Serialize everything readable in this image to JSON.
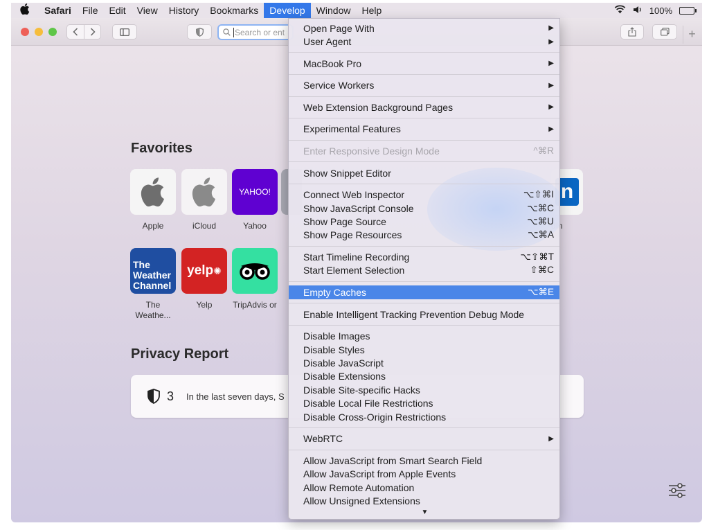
{
  "menubar": {
    "app": "Safari",
    "items": [
      "File",
      "Edit",
      "View",
      "History",
      "Bookmarks",
      "Develop",
      "Window",
      "Help"
    ],
    "active": "Develop",
    "battery": "100%",
    "icons": [
      "apple-logo-icon",
      "wifi-icon",
      "volume-icon",
      "battery-icon"
    ]
  },
  "toolbar": {
    "address_placeholder": "Search or ent"
  },
  "favorites": {
    "title": "Favorites",
    "items": [
      {
        "label": "Apple",
        "icon": "apple-logo-icon"
      },
      {
        "label": "iCloud",
        "icon": "apple-logo-icon"
      },
      {
        "label": "Yahoo",
        "tile_text": "YAHOO!"
      },
      {
        "label": "dIn",
        "tile_text": "n"
      },
      {
        "label": "The Weathe...",
        "tile_text": "The Weather Channel"
      },
      {
        "label": "Yelp",
        "tile_text": "yelp"
      },
      {
        "label": "TripAdvis or",
        "icon": "tripadvisor-owl-icon"
      }
    ]
  },
  "privacy": {
    "title": "Privacy Report",
    "count": "3",
    "text": "In the last seven days, S"
  },
  "develop_menu": {
    "groups": [
      [
        {
          "label": "Open Page With",
          "submenu": true
        },
        {
          "label": "User Agent",
          "submenu": true
        }
      ],
      [
        {
          "label": "MacBook Pro",
          "submenu": true
        }
      ],
      [
        {
          "label": "Service Workers",
          "submenu": true
        }
      ],
      [
        {
          "label": "Web Extension Background Pages",
          "submenu": true
        }
      ],
      [
        {
          "label": "Experimental Features",
          "submenu": true
        }
      ],
      [
        {
          "label": "Enter Responsive Design Mode",
          "shortcut": "^⌘R",
          "disabled": true
        }
      ],
      [
        {
          "label": "Show Snippet Editor"
        }
      ],
      [
        {
          "label": "Connect Web Inspector",
          "shortcut": "⌥⇧⌘I"
        },
        {
          "label": "Show JavaScript Console",
          "shortcut": "⌥⌘C"
        },
        {
          "label": "Show Page Source",
          "shortcut": "⌥⌘U"
        },
        {
          "label": "Show Page Resources",
          "shortcut": "⌥⌘A"
        }
      ],
      [
        {
          "label": "Start Timeline Recording",
          "shortcut": "⌥⇧⌘T"
        },
        {
          "label": "Start Element Selection",
          "shortcut": "⇧⌘C"
        }
      ],
      [
        {
          "label": "Empty Caches",
          "shortcut": "⌥⌘E",
          "highlighted": true
        }
      ],
      [
        {
          "label": "Enable Intelligent Tracking Prevention Debug Mode"
        }
      ],
      [
        {
          "label": "Disable Images"
        },
        {
          "label": "Disable Styles"
        },
        {
          "label": "Disable JavaScript"
        },
        {
          "label": "Disable Extensions"
        },
        {
          "label": "Disable Site-specific Hacks"
        },
        {
          "label": "Disable Local File Restrictions"
        },
        {
          "label": "Disable Cross-Origin Restrictions"
        }
      ],
      [
        {
          "label": "WebRTC",
          "submenu": true
        }
      ],
      [
        {
          "label": "Allow JavaScript from Smart Search Field"
        },
        {
          "label": "Allow JavaScript from Apple Events"
        },
        {
          "label": "Allow Remote Automation"
        },
        {
          "label": "Allow Unsigned Extensions"
        }
      ]
    ],
    "submenu_arrow": "▶",
    "more_arrow": "▼"
  },
  "colors": {
    "menu_highlight": "#4a86e8",
    "menubar_active": "#3478e9",
    "yahoo": "#5f01d1",
    "weather": "#1f4ea1",
    "yelp": "#d32323",
    "tripadvisor": "#34e0a1",
    "linkedin": "#0a66c2"
  }
}
